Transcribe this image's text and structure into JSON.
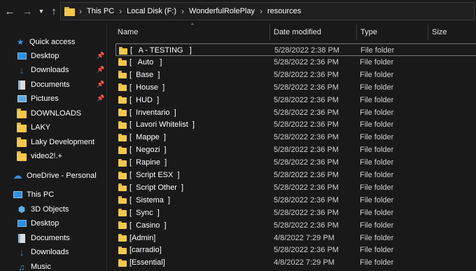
{
  "address": {
    "crumbs": [
      "This PC",
      "Local Disk (F:)",
      "WonderfulRolePlay",
      "resources"
    ]
  },
  "sidebar": {
    "quick_access": "Quick access",
    "items": [
      {
        "label": "Desktop",
        "icon": "desktop-icon",
        "pinned": true
      },
      {
        "label": "Downloads",
        "icon": "download-icon",
        "pinned": true
      },
      {
        "label": "Documents",
        "icon": "documents-icon",
        "pinned": true
      },
      {
        "label": "Pictures",
        "icon": "pictures-icon",
        "pinned": true
      },
      {
        "label": "DOWNLOADS",
        "icon": "folder-icon",
        "pinned": false
      },
      {
        "label": "LAKY",
        "icon": "folder-icon",
        "pinned": false
      },
      {
        "label": "Laky Development",
        "icon": "folder-icon",
        "pinned": false
      },
      {
        "label": "video2!.+",
        "icon": "folder-icon",
        "pinned": false
      }
    ],
    "onedrive": "OneDrive - Personal",
    "this_pc": "This PC",
    "pc_items": [
      {
        "label": "3D Objects",
        "icon": "3d-objects-icon"
      },
      {
        "label": "Desktop",
        "icon": "desktop-icon"
      },
      {
        "label": "Documents",
        "icon": "documents-icon"
      },
      {
        "label": "Downloads",
        "icon": "download-icon"
      },
      {
        "label": "Music",
        "icon": "music-icon"
      }
    ]
  },
  "columns": {
    "name": "Name",
    "date": "Date modified",
    "type": "Type",
    "size": "Size"
  },
  "files": [
    {
      "name": "[   A - TESTING   ]",
      "date": "5/28/2022 2:38 PM",
      "type": "File folder"
    },
    {
      "name": "[   Auto   ]",
      "date": "5/28/2022 2:36 PM",
      "type": "File folder"
    },
    {
      "name": "[  Base  ]",
      "date": "5/28/2022 2:36 PM",
      "type": "File folder"
    },
    {
      "name": "[  House  ]",
      "date": "5/28/2022 2:36 PM",
      "type": "File folder"
    },
    {
      "name": "[  HUD  ]",
      "date": "5/28/2022 2:36 PM",
      "type": "File folder"
    },
    {
      "name": "[  Inventario  ]",
      "date": "5/28/2022 2:36 PM",
      "type": "File folder"
    },
    {
      "name": "[  Lavori Whitelist  ]",
      "date": "5/28/2022 2:36 PM",
      "type": "File folder"
    },
    {
      "name": "[  Mappe  ]",
      "date": "5/28/2022 2:36 PM",
      "type": "File folder"
    },
    {
      "name": "[  Negozi  ]",
      "date": "5/28/2022 2:36 PM",
      "type": "File folder"
    },
    {
      "name": "[  Rapine  ]",
      "date": "5/28/2022 2:36 PM",
      "type": "File folder"
    },
    {
      "name": "[  Script ESX  ]",
      "date": "5/28/2022 2:36 PM",
      "type": "File folder"
    },
    {
      "name": "[  Script Other  ]",
      "date": "5/28/2022 2:36 PM",
      "type": "File folder"
    },
    {
      "name": "[  Sistema  ]",
      "date": "5/28/2022 2:36 PM",
      "type": "File folder"
    },
    {
      "name": "[  Sync  ]",
      "date": "5/28/2022 2:36 PM",
      "type": "File folder"
    },
    {
      "name": "[  Casino  ]",
      "date": "5/28/2022 2:36 PM",
      "type": "File folder"
    },
    {
      "name": "[Admin]",
      "date": "4/8/2022 7:29 PM",
      "type": "File folder"
    },
    {
      "name": "[carradio]",
      "date": "5/28/2022 2:36 PM",
      "type": "File folder"
    },
    {
      "name": "[Essential]",
      "date": "4/8/2022 7:29 PM",
      "type": "File folder"
    }
  ],
  "colors": {
    "background": "#191919",
    "folder": "#f3c84b",
    "accent_blue": "#3a8fe0"
  }
}
